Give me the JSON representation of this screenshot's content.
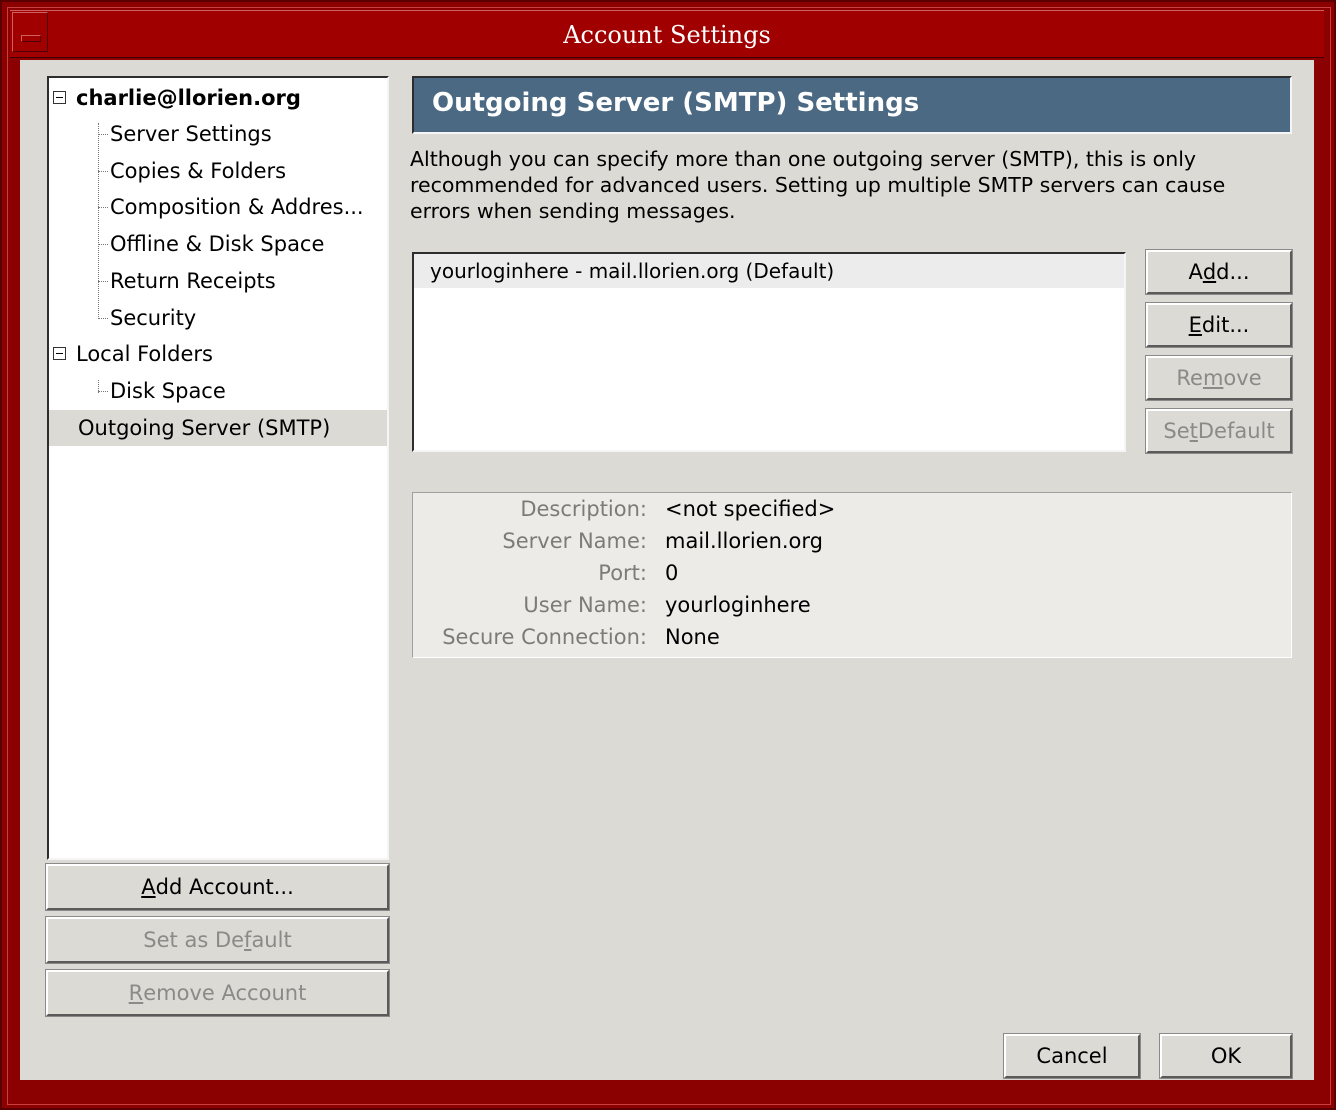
{
  "window": {
    "title": "Account Settings"
  },
  "tree": {
    "account": "charlie@llorien.org",
    "account_items": [
      "Server Settings",
      "Copies & Folders",
      "Composition & Addres...",
      "Offline & Disk Space",
      "Return Receipts",
      "Security"
    ],
    "local_folders": "Local Folders",
    "local_items": [
      "Disk Space"
    ],
    "outgoing": "Outgoing Server (SMTP)"
  },
  "account_buttons": {
    "add_prefix": "",
    "add_mnemonic": "A",
    "add_suffix": "dd Account...",
    "default_prefix": "Set as De",
    "default_mnemonic": "f",
    "default_suffix": "ault",
    "remove_prefix": "",
    "remove_mnemonic": "R",
    "remove_suffix": "emove Account"
  },
  "panel": {
    "title": "Outgoing Server (SMTP) Settings",
    "description": "Although you can specify more than one outgoing server (SMTP), this is only recommended for advanced users. Setting up multiple SMTP servers can cause errors when sending messages.",
    "servers": [
      "yourloginhere - mail.llorien.org (Default)"
    ]
  },
  "server_buttons": {
    "add_prefix": "A",
    "add_mnemonic": "d",
    "add_suffix": "d...",
    "edit_prefix": "",
    "edit_mnemonic": "E",
    "edit_suffix": "dit...",
    "remove_prefix": "Re",
    "remove_mnemonic": "m",
    "remove_suffix": "ove",
    "default_prefix": "Se",
    "default_mnemonic": "t",
    "default_suffix": " Default"
  },
  "details": {
    "description_label": "Description:",
    "description_value": "<not specified>",
    "server_label": "Server Name:",
    "server_value": "mail.llorien.org",
    "port_label": "Port:",
    "port_value": "0",
    "user_label": "User Name:",
    "user_value": "yourloginhere",
    "secure_label": "Secure Connection:",
    "secure_value": "None"
  },
  "dialog_buttons": {
    "cancel": "Cancel",
    "ok": "OK"
  },
  "colors": {
    "frame": "#8b0000",
    "header": "#4b6983",
    "background": "#dcdad5"
  }
}
